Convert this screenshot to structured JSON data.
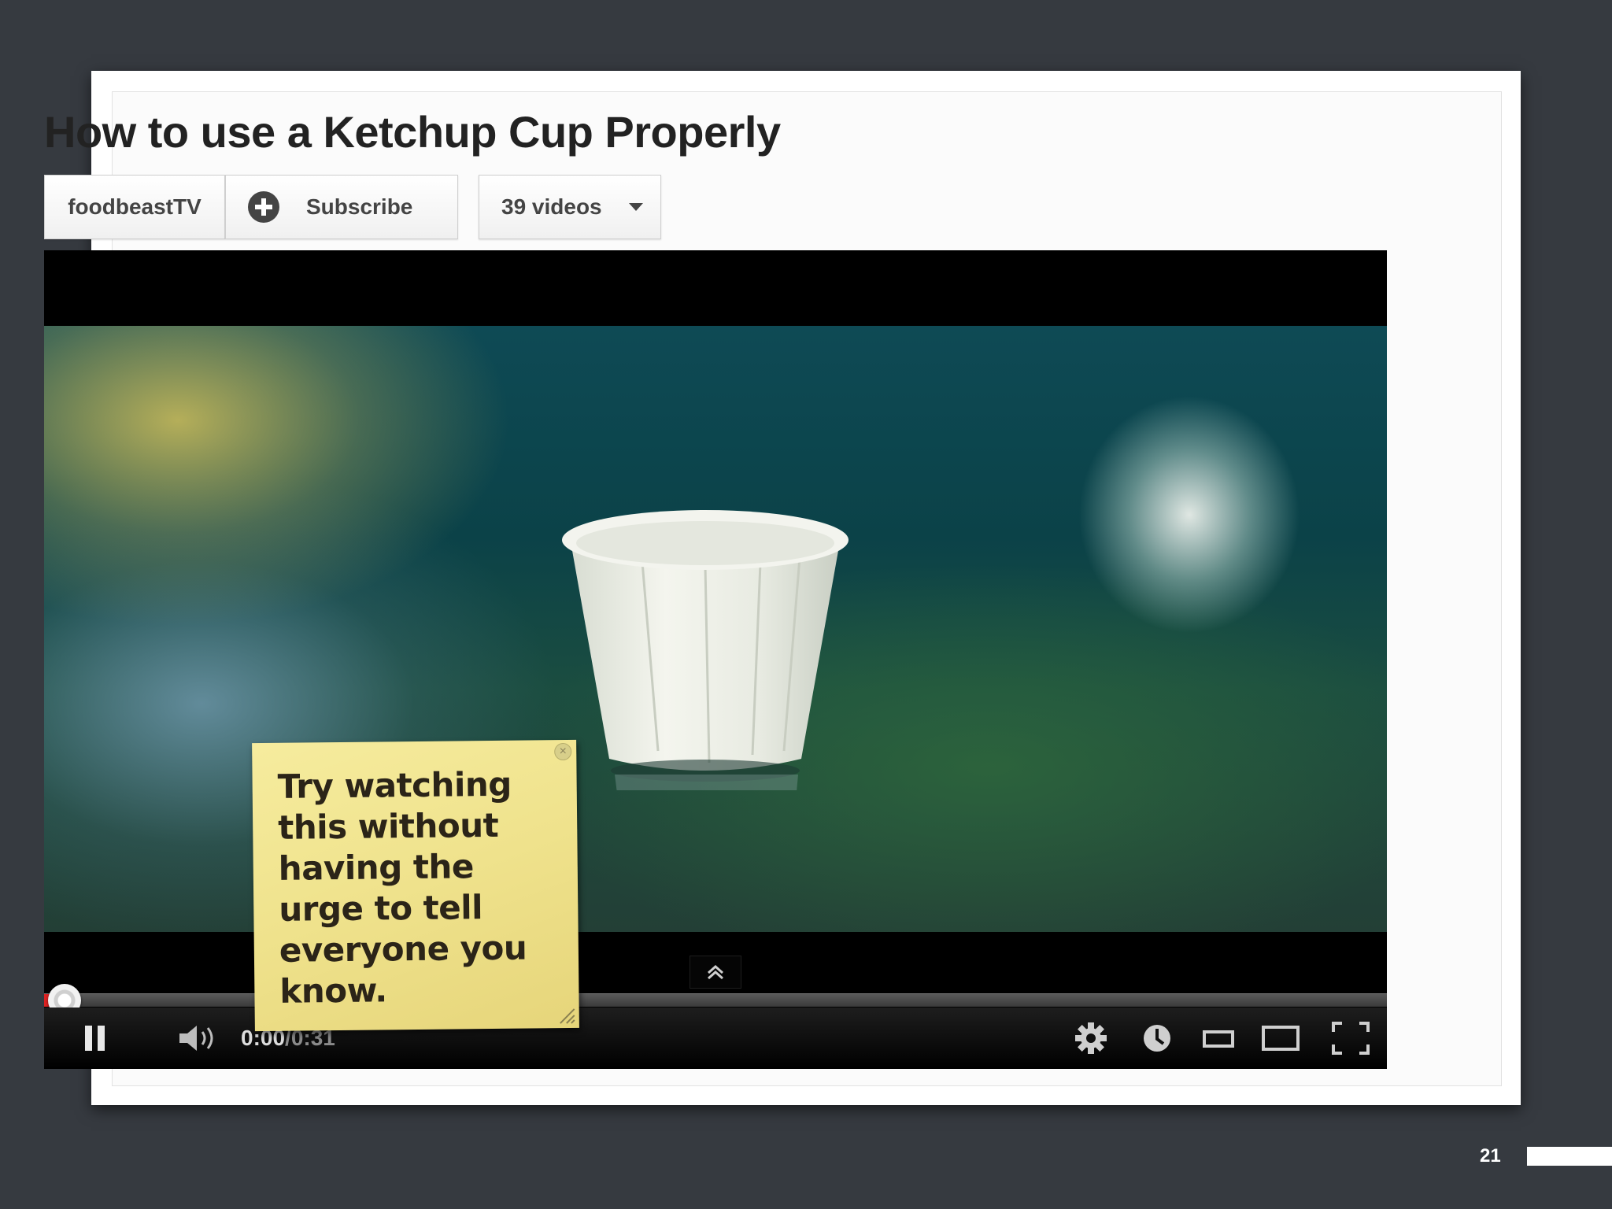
{
  "video": {
    "title": "How to use a Ketchup Cup Properly",
    "channel": "foodbeastTV",
    "subscribe_label": "Subscribe",
    "videos_label": "39 videos"
  },
  "player": {
    "current_time": "0:00",
    "time_separator": " / ",
    "total_time": "0:31",
    "progress": 0.0
  },
  "note": {
    "text": "Try watching this without having the urge to tell everyone you know."
  },
  "slide": {
    "page_number": "21"
  },
  "colors": {
    "background": "#363a40",
    "progress_played": "#dd2222",
    "note": "#f2e690"
  },
  "icons": [
    "plus-icon",
    "caret-down-icon",
    "chevron-up-icon",
    "pause-icon",
    "volume-icon",
    "gear-icon",
    "clock-icon",
    "small-player-icon",
    "large-player-icon",
    "fullscreen-icon",
    "close-icon",
    "resize-grip-icon"
  ]
}
